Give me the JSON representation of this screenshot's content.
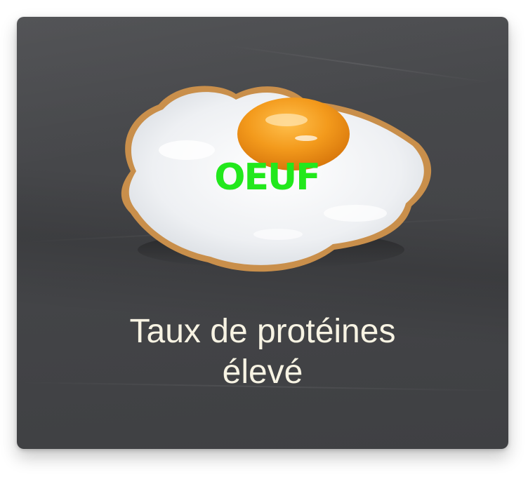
{
  "card": {
    "egg_label": "OEUF",
    "caption_line1": "Taux de protéines",
    "caption_line2": "élevé"
  },
  "colors": {
    "background": "#444548",
    "label": "#22e81c",
    "caption": "#f7f3e3",
    "yolk": "#f39a1c"
  },
  "images": {
    "egg": "fried-egg-image"
  }
}
